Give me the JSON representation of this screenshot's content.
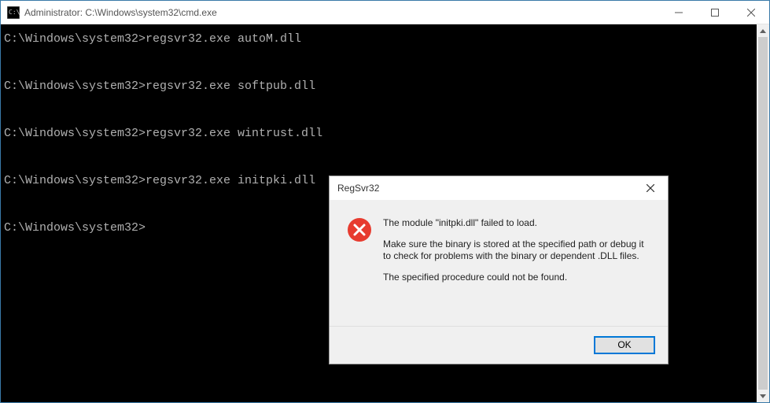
{
  "window": {
    "title": "Administrator: C:\\Windows\\system32\\cmd.exe"
  },
  "terminal": {
    "lines": [
      "C:\\Windows\\system32>regsvr32.exe autoM.dll",
      "",
      "C:\\Windows\\system32>regsvr32.exe softpub.dll",
      "",
      "C:\\Windows\\system32>regsvr32.exe wintrust.dll",
      "",
      "C:\\Windows\\system32>regsvr32.exe initpki.dll",
      "",
      "C:\\Windows\\system32>"
    ]
  },
  "dialog": {
    "title": "RegSvr32",
    "line1": "The module \"initpki.dll\" failed to load.",
    "line2": "Make sure the binary is stored at the specified path or debug it to check for problems with the binary or dependent .DLL files.",
    "line3": "The specified procedure could not be found.",
    "ok_label": "OK"
  }
}
